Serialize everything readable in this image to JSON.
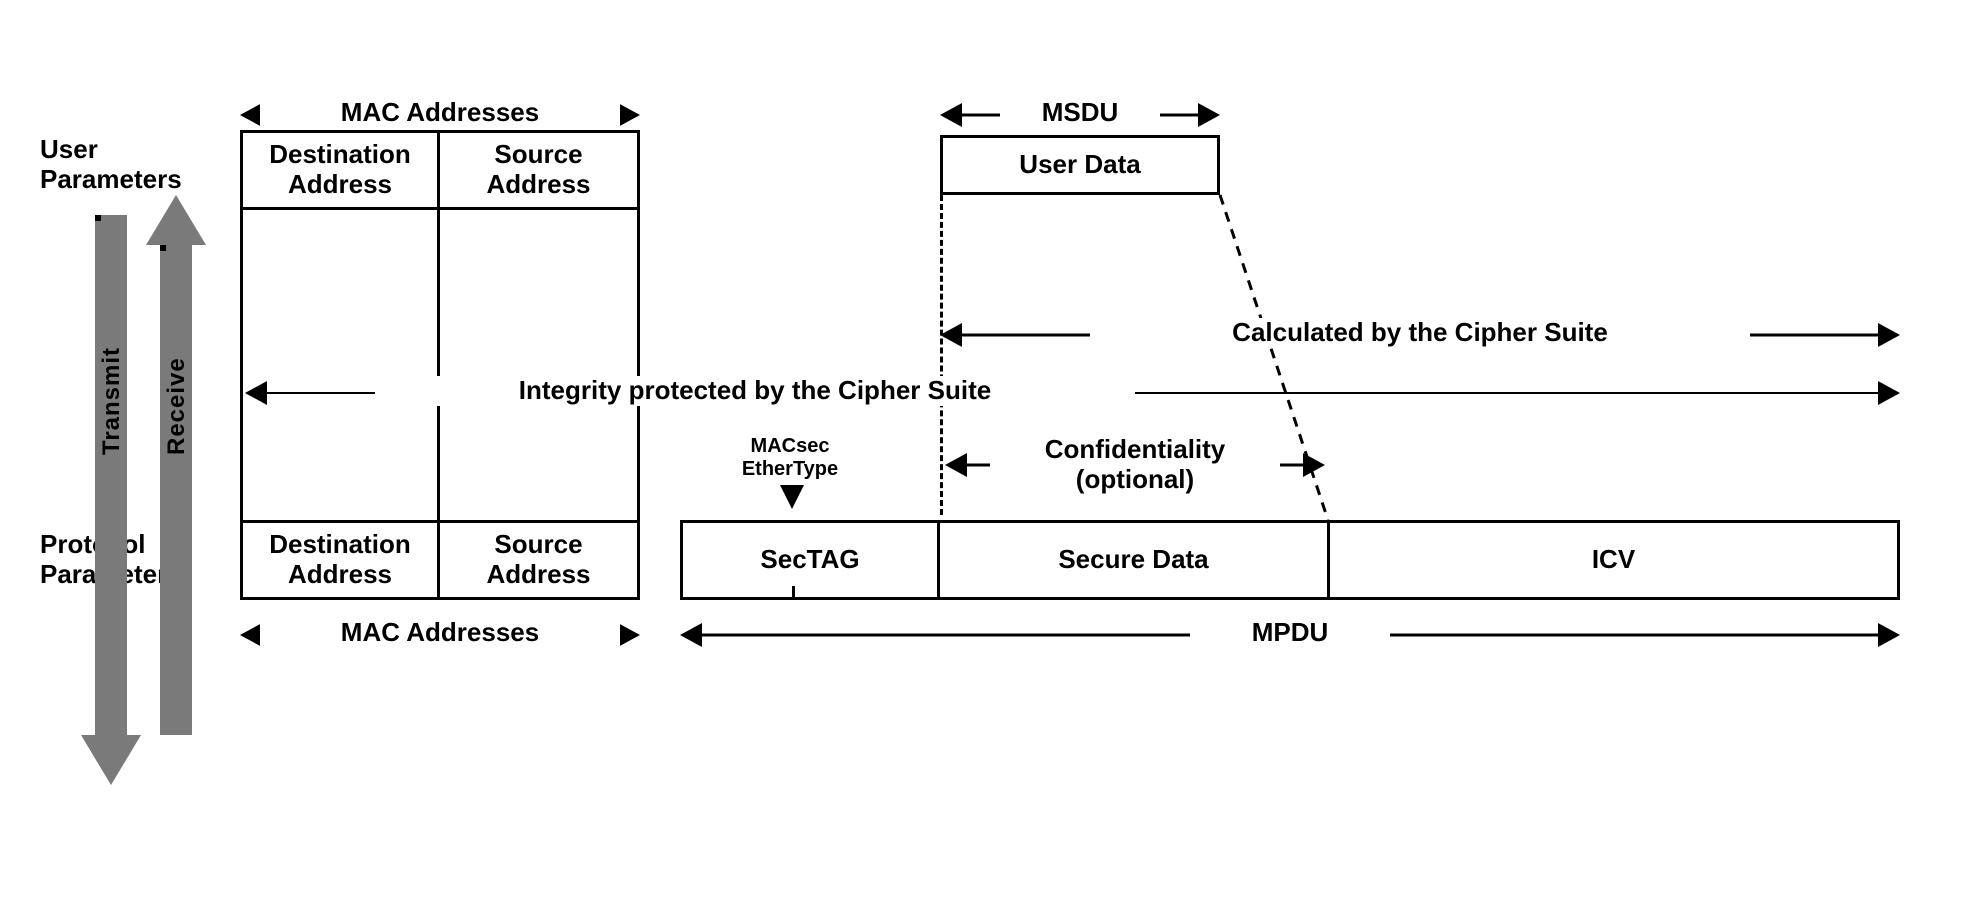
{
  "left": {
    "user_parameters": "User\nParameters",
    "protocol_parameters": "Protocol\nParameters",
    "transmit": "Transmit",
    "receive": "Receive"
  },
  "mac": {
    "label": "MAC Addresses",
    "dest": "Destination\nAddress",
    "src": "Source\nAddress"
  },
  "right": {
    "msdu": "MSDU",
    "user_data": "User Data",
    "integrity": "Integrity protected by the Cipher Suite",
    "calculated": "Calculated by the Cipher Suite",
    "macsec_ethertype": "MACsec\nEtherType",
    "confidentiality": "Confidentiality\n(optional)",
    "sectag": "SecTAG",
    "secure_data": "Secure Data",
    "icv": "ICV",
    "mpdu": "MPDU"
  }
}
